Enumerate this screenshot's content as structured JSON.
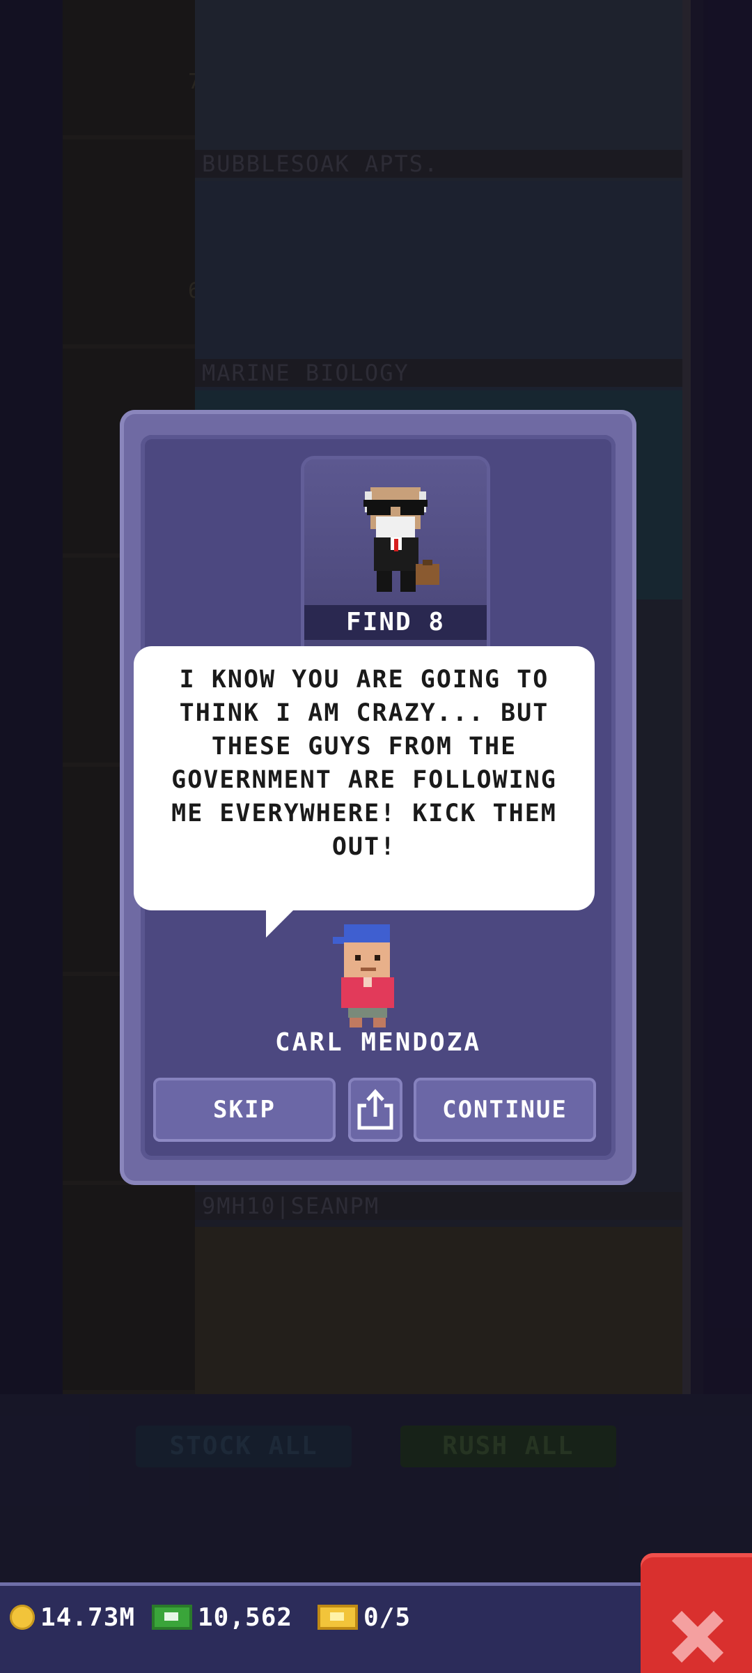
{
  "background": {
    "floors": [
      {
        "name": "BUBBLESOAK APTS.",
        "level": "7"
      },
      {
        "name": "MARINE BIOLOGY",
        "level": "6"
      },
      {
        "name": "9MH10|SEANPM",
        "level": ""
      }
    ],
    "stock_all_label": "STOCK ALL",
    "rush_all_label": "RUSH ALL"
  },
  "dialog": {
    "find_label": "FIND 8",
    "message": "I KNOW YOU ARE GOING TO THINK I AM CRAZY... BUT THESE GUYS FROM THE GOVERNMENT ARE FOLLOWING ME EVERYWHERE! KICK THEM OUT!",
    "speaker_name": "CARL MENDOZA",
    "skip_label": "SKIP",
    "continue_label": "CONTINUE"
  },
  "hud": {
    "coins": "14.73M",
    "bux": "10,562",
    "tickets": "0/5"
  },
  "colors": {
    "dialog_outer": "#6f6aa3",
    "dialog_inner": "#4c4880",
    "button": "#6b67a6",
    "close_button": "#d9302e",
    "hud_bar": "#2c2c5a"
  },
  "icons": {
    "share": "share-icon",
    "close": "close-icon",
    "coin": "coin-icon",
    "bux": "bux-icon",
    "ticket": "ticket-icon"
  }
}
